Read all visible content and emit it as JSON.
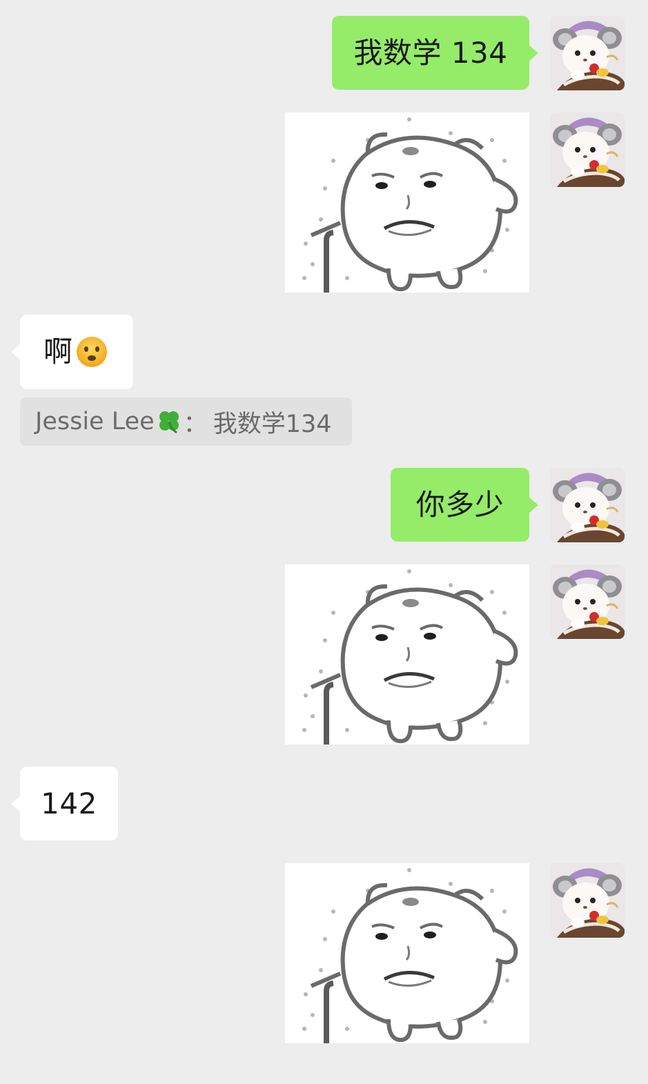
{
  "conversation": {
    "messages": [
      {
        "sender": "me",
        "type": "text",
        "text": "我数学 134"
      },
      {
        "sender": "me",
        "type": "sticker",
        "sticker": "grumpy-bear-sticker"
      },
      {
        "sender": "other",
        "type": "text",
        "text": "啊",
        "emoji": "frowning-face-emoji"
      },
      {
        "sender": "other",
        "type": "quote",
        "quote_author": "Jessie Lee",
        "quote_separator": "：",
        "quote_text": "我数学134",
        "quote_icon": "four-leaf-clover-emoji"
      },
      {
        "sender": "me",
        "type": "text",
        "text": "你多少"
      },
      {
        "sender": "me",
        "type": "sticker",
        "sticker": "grumpy-bear-sticker"
      },
      {
        "sender": "other",
        "type": "text",
        "text": "142"
      },
      {
        "sender": "me",
        "type": "sticker",
        "sticker": "grumpy-bear-sticker"
      }
    ]
  },
  "colors": {
    "background": "#ededed",
    "outgoing_bubble": "#95ec69",
    "incoming_bubble": "#ffffff",
    "quote_background": "#e1e1e1",
    "text": "#191919",
    "quote_text": "#6b6b6b"
  }
}
